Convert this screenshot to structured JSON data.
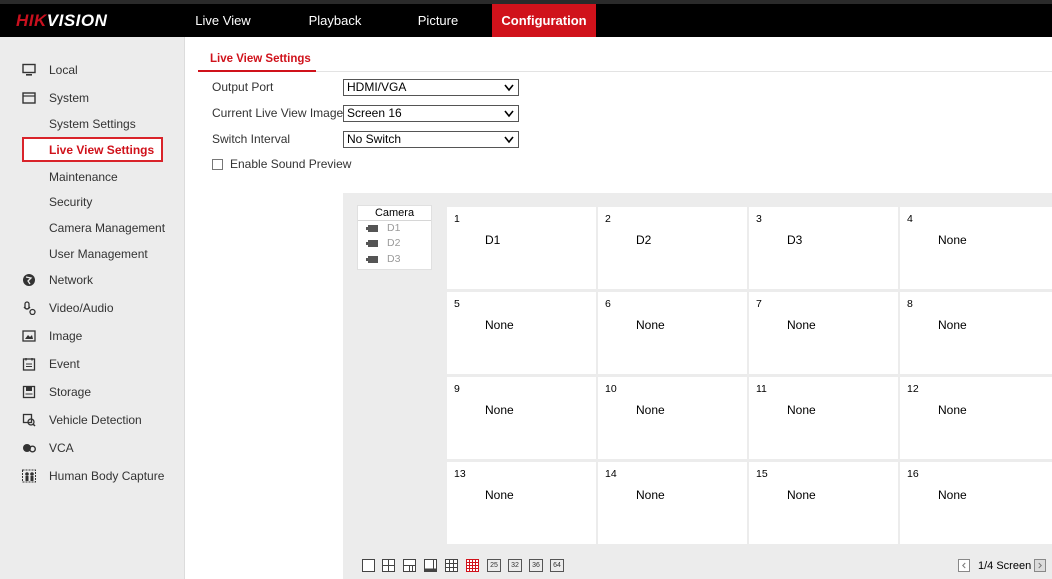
{
  "nav": {
    "logo_hik": "HIK",
    "logo_vision": "VISION",
    "items": [
      {
        "label": "Live View"
      },
      {
        "label": "Playback"
      },
      {
        "label": "Picture"
      },
      {
        "label": "Configuration"
      }
    ]
  },
  "sidebar": {
    "items": [
      {
        "label": "Local"
      },
      {
        "label": "System"
      },
      {
        "label": "System Settings"
      },
      {
        "label": "Live View Settings"
      },
      {
        "label": "Maintenance"
      },
      {
        "label": "Security"
      },
      {
        "label": "Camera Management"
      },
      {
        "label": "User Management"
      },
      {
        "label": "Network"
      },
      {
        "label": "Video/Audio"
      },
      {
        "label": "Image"
      },
      {
        "label": "Event"
      },
      {
        "label": "Storage"
      },
      {
        "label": "Vehicle Detection"
      },
      {
        "label": "VCA"
      },
      {
        "label": "Human Body Capture"
      }
    ]
  },
  "main": {
    "tab_label": "Live View Settings",
    "output_port_label": "Output Port",
    "output_port_value": "HDMI/VGA",
    "current_image_label": "Current Live View Image",
    "current_image_value": "Screen 16",
    "switch_interval_label": "Switch Interval",
    "switch_interval_value": "No Switch",
    "sound_preview_label": "Enable Sound Preview",
    "sound_preview_checked": false
  },
  "camera_list": {
    "title": "Camera",
    "items": [
      "D1",
      "D2",
      "D3"
    ]
  },
  "grid": {
    "cells": [
      {
        "num": "1",
        "value": "D1"
      },
      {
        "num": "2",
        "value": "D2"
      },
      {
        "num": "3",
        "value": "D3"
      },
      {
        "num": "4",
        "value": "None"
      },
      {
        "num": "5",
        "value": "None"
      },
      {
        "num": "6",
        "value": "None"
      },
      {
        "num": "7",
        "value": "None"
      },
      {
        "num": "8",
        "value": "None"
      },
      {
        "num": "9",
        "value": "None"
      },
      {
        "num": "10",
        "value": "None"
      },
      {
        "num": "11",
        "value": "None"
      },
      {
        "num": "12",
        "value": "None"
      },
      {
        "num": "13",
        "value": "None"
      },
      {
        "num": "14",
        "value": "None"
      },
      {
        "num": "15",
        "value": "None"
      },
      {
        "num": "16",
        "value": "None"
      }
    ],
    "layout_text_buttons": [
      "25",
      "32",
      "36",
      "64"
    ],
    "pager_text": "1/4 Screen"
  },
  "colors": {
    "brand_red": "#d0121b",
    "sidebar_bg": "#ececec"
  }
}
